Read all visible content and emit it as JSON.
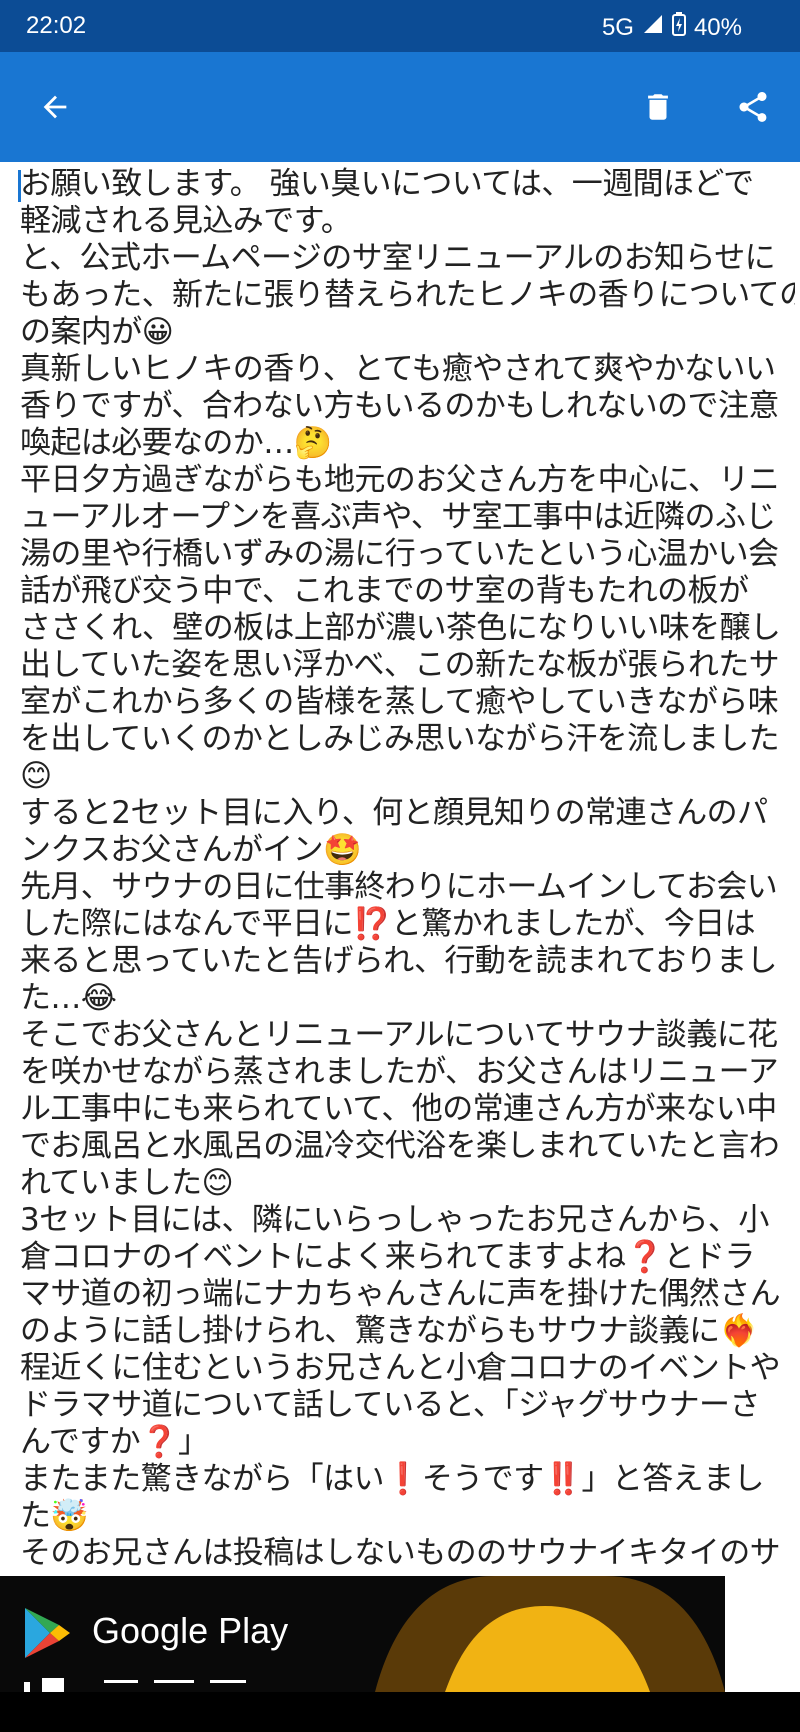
{
  "status_bar": {
    "time": "22:02",
    "network": "5G",
    "battery": "40%"
  },
  "colors": {
    "status_bar": "#0c4c95",
    "app_bar": "#1976d2",
    "text": "#222222",
    "ad_background": "#090909"
  },
  "icons": {
    "back": "arrow-left-icon",
    "delete": "trash-icon",
    "share": "share-icon"
  },
  "content": {
    "lines": [
      "お願い致します。 強い臭いについては、一週間ほどで",
      "軽減される見込みです。",
      "と、公式ホームページのサ室リニューアルのお知らせに",
      "もあった、新たに張り替えられたヒノキの香りについての",
      "の案内が😀",
      "真新しいヒノキの香り、とても癒やされて爽やかないい",
      "香りですが、合わない方もいるのかもしれないので注意",
      "喚起は必要なのか…🤔",
      "平日夕方過ぎながらも地元のお父さん方を中心に、リニ",
      "ューアルオープンを喜ぶ声や、サ室工事中は近隣のふじ",
      "湯の里や行橋いずみの湯に行っていたという心温かい会",
      "話が飛び交う中で、これまでのサ室の背もたれの板が",
      "ささくれ、壁の板は上部が濃い茶色になりいい味を醸し",
      "出していた姿を思い浮かべ、この新たな板が張られたサ",
      "室がこれから多くの皆様を蒸して癒やしていきながら味",
      "を出していくのかとしみじみ思いながら汗を流しました",
      "😊",
      "すると2セット目に入り、何と顔見知りの常連さんのパ",
      "ンクスお父さんがイン🤩",
      "先月、サウナの日に仕事終わりにホームインしてお会い",
      "した際にはなんで平日に⁉️と驚かれましたが、今日は",
      "来ると思っていたと告げられ、行動を読まれておりまし",
      "た…😂",
      "そこでお父さんとリニューアルについてサウナ談義に花",
      "を咲かせながら蒸されましたが、お父さんはリニューア",
      "ル工事中にも来られていて、他の常連さん方が来ない中",
      "でお風呂と水風呂の温冷交代浴を楽しまれていたと言わ",
      "れていました😊",
      "3セット目には、隣にいらっしゃったお兄さんから、小",
      "倉コロナのイベントによく来られてますよね❓とドラ",
      "マサ道の初っ端にナカちゃんさんに声を掛けた偶然さん",
      "のように話し掛けられ、驚きながらもサウナ談義に❤️‍🔥",
      "程近くに住むというお兄さんと小倉コロナのイベントや",
      "ドラマサ道について話していると、「ジャグサウナーさ",
      "んですか❓」",
      "またまた驚きながら「はい❗そうです‼️」と答えまし",
      "た🤯",
      "そのお兄さんは投稿はしないもののサウナイキタイのサ"
    ]
  },
  "ad": {
    "brand": "Google Play"
  }
}
